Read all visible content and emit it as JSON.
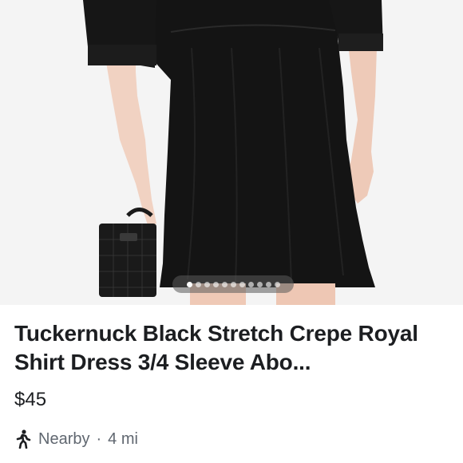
{
  "listing": {
    "title": "Tuckernuck Black Stretch Crepe Royal Shirt Dress 3/4 Sleeve Abo...",
    "price": "$45",
    "location": {
      "label": "Nearby",
      "separator": "·",
      "distance": "4 mi",
      "icon": "walking-person-icon"
    }
  },
  "carousel": {
    "total": 11,
    "active_index": 0
  },
  "colors": {
    "dress": "#141414",
    "background": "#f4f4f4",
    "text_primary": "#1c1e21",
    "text_secondary": "#606770"
  }
}
